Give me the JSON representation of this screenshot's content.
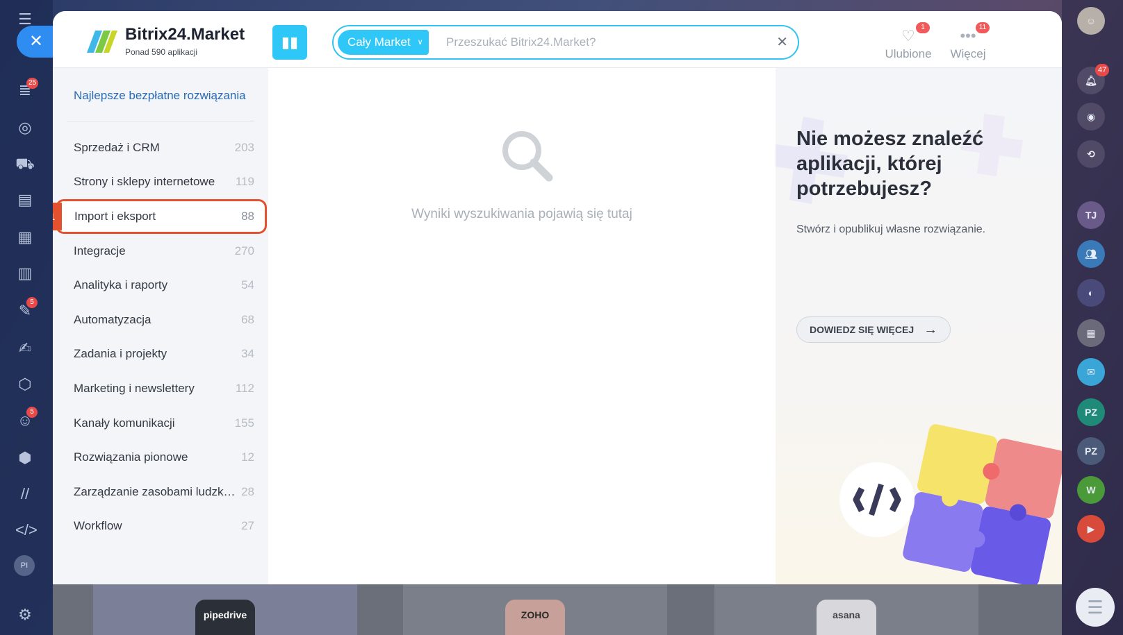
{
  "app": {
    "title": "Bitrix24.Market",
    "subtitle": "Ponad 590 aplikacji"
  },
  "search": {
    "scope_label": "Cały Market",
    "placeholder": "Przeszukać Bitrix24.Market?",
    "value": ""
  },
  "header_actions": {
    "favorites_label": "Ulubione",
    "favorites_badge": "1",
    "more_label": "Więcej",
    "more_badge": "11"
  },
  "sidebar": {
    "top_link": "Najlepsze bezpłatne rozwiązania",
    "categories": [
      {
        "name": "Sprzedaż i CRM",
        "count": "203"
      },
      {
        "name": "Strony i sklepy internetowe",
        "count": "119"
      },
      {
        "name": "Import i eksport",
        "count": "88",
        "selected": true,
        "step": "1"
      },
      {
        "name": "Integracje",
        "count": "270"
      },
      {
        "name": "Analityka i raporty",
        "count": "54"
      },
      {
        "name": "Automatyzacja",
        "count": "68"
      },
      {
        "name": "Zadania i projekty",
        "count": "34"
      },
      {
        "name": "Marketing i newslettery",
        "count": "112"
      },
      {
        "name": "Kanały komunikacji",
        "count": "155"
      },
      {
        "name": "Rozwiązania pionowe",
        "count": "12"
      },
      {
        "name": "Zarządzanie zasobami ludzkimi",
        "count": "28"
      },
      {
        "name": "Workflow",
        "count": "27"
      }
    ]
  },
  "center": {
    "empty_text": "Wyniki wyszukiwania pojawią się tutaj"
  },
  "promo": {
    "title": "Nie możesz znaleźć aplikacji, której potrzebujesz?",
    "subtitle": "Stwórz i opublikuj własne rozwiązanie.",
    "button_label": "DOWIEDZ SIĘ WIĘCEJ"
  },
  "left_nav": {
    "badges": [
      "25",
      "5",
      "5"
    ],
    "avatar_initials": "PI"
  },
  "right_nav": {
    "notifications_badge": "47",
    "avatars": [
      "TJ",
      "PZ",
      "PZ",
      "W"
    ]
  },
  "bottom_cards": [
    "pipedrive",
    "ZOHO",
    "asana"
  ],
  "colors": {
    "accent": "#2fc7f7",
    "highlight": "#e4512f",
    "link": "#2a6bb5"
  }
}
